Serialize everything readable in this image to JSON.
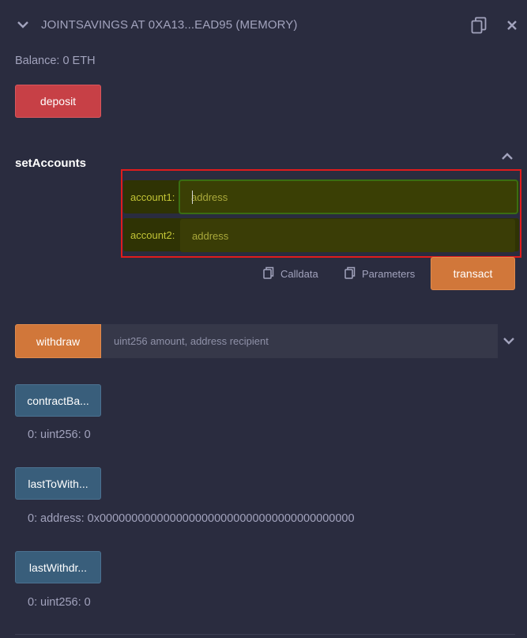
{
  "header": {
    "title": "JOINTSAVINGS AT 0XA13...EAD95 (MEMORY)"
  },
  "balance": "Balance: 0 ETH",
  "deposit": {
    "label": "deposit"
  },
  "set_accounts": {
    "label": "setAccounts",
    "fields": [
      {
        "label": "account1:",
        "placeholder": "address"
      },
      {
        "label": "account2:",
        "placeholder": "address"
      }
    ],
    "calldata_label": "Calldata",
    "parameters_label": "Parameters",
    "transact_label": "transact"
  },
  "withdraw": {
    "label": "withdraw",
    "placeholder": "uint256 amount, address recipient"
  },
  "functions": [
    {
      "label": "contractBa...",
      "result_index": "0:",
      "result": "uint256: 0"
    },
    {
      "label": "lastToWith...",
      "result_index": "0:",
      "result": "address: 0x0000000000000000000000000000000000000000"
    },
    {
      "label": "lastWithdr...",
      "result_index": "0:",
      "result": "uint256: 0"
    }
  ],
  "colors": {
    "background": "#2a2c3f",
    "deposit": "#c74046",
    "transact": "#d1773a",
    "call": "#395e7b",
    "highlight": "#e01c1c"
  },
  "icons": [
    "chevron-down-icon",
    "copy-icon",
    "close-icon",
    "chevron-up-icon",
    "clipboard-icon"
  ]
}
